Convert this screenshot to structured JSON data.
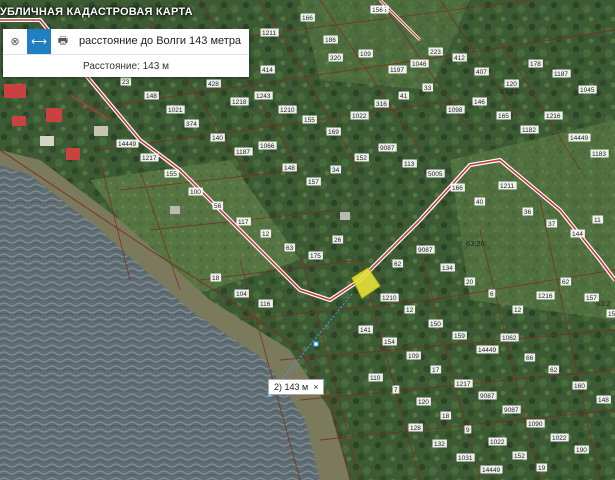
{
  "app_title": "УБЛИЧНАЯ КАДАСТРОВАЯ КАРТА",
  "measure_tool": {
    "title": "расстояние до Волги 143 метра",
    "distance_label": "Расстояние: 143 м",
    "tools": [
      {
        "name": "clear-icon",
        "glyph": "⊗"
      },
      {
        "name": "ruler-icon",
        "glyph": "⟷"
      },
      {
        "name": "print-icon",
        "glyph": "🖶"
      }
    ]
  },
  "map_label": {
    "text": "2) 143 м",
    "close": "×"
  },
  "quarter_labels": [
    "63:26:",
    "63:26:",
    "63:2"
  ],
  "plot_labels": [
    "1045",
    "166",
    "186",
    "1211",
    "180",
    "414",
    "320",
    "109",
    "1197",
    "1046",
    "223",
    "412",
    "407",
    "120",
    "178",
    "1187",
    "1045",
    "428",
    "1218",
    "1243",
    "1210",
    "155",
    "169",
    "1022",
    "316",
    "41",
    "33",
    "1098",
    "146",
    "165",
    "1182",
    "1216",
    "14449",
    "1183",
    "374",
    "140",
    "1187",
    "1066",
    "148",
    "157",
    "34",
    "152",
    "9087",
    "113",
    "5005",
    "166",
    "40",
    "1211",
    "36",
    "37",
    "144",
    "11",
    "14449",
    "1217",
    "155",
    "100",
    "56",
    "117",
    "12",
    "63",
    "175",
    "26",
    "62",
    "9087",
    "134",
    "20",
    "6",
    "12",
    "1216",
    "62",
    "157",
    "159",
    "18",
    "104",
    "116",
    "1210",
    "12",
    "150",
    "159",
    "14449",
    "1062",
    "66",
    "62",
    "160",
    "148",
    "141",
    "154",
    "109",
    "17",
    "1217",
    "9087",
    "9087",
    "1090",
    "1022",
    "190",
    "110",
    "7",
    "120",
    "18",
    "9",
    "1022",
    "152",
    "19",
    "128",
    "132",
    "1031",
    "14449",
    "23",
    "148",
    "1021",
    "156"
  ]
}
